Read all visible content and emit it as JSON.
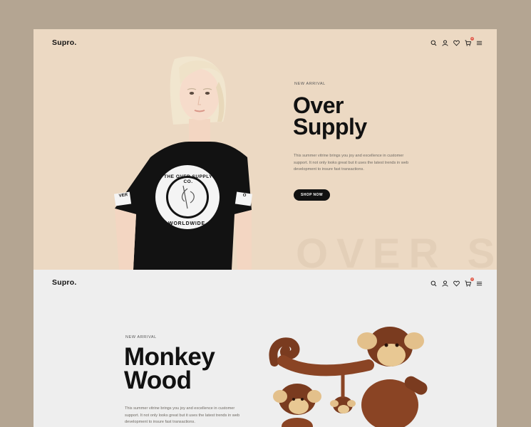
{
  "hero_one": {
    "logo": "Supro.",
    "eyebrow": "NEW ARRIVAL",
    "title_line1": "Over",
    "title_line2": "Supply",
    "description": "This summer vitrine brings you joy and excellence in customer support. It not only looks great but it uses the latest trends in web development to insure fast transactions.",
    "cta": "SHOP NOW",
    "watermark": "OVER S",
    "shirt_print_top": "THE OVER SUPPLY CO.",
    "shirt_print_bottom": "WORLDWIDE",
    "sleeve_left": "VER",
    "sleeve_right": "O",
    "cart_count": "0"
  },
  "hero_two": {
    "logo": "Supro.",
    "eyebrow": "NEW ARRIVAL",
    "title_line1": "Monkey",
    "title_line2": "Wood",
    "description": "This summer vitrine brings you joy and excellence in customer support. It not only looks great but it uses the latest trends in web development to insure fast transactions.",
    "cart_count": "0"
  },
  "icons": [
    "search-icon",
    "user-icon",
    "heart-icon",
    "cart-icon",
    "menu-icon"
  ],
  "colors": {
    "page_bg": "#b4a592",
    "hero_one_bg": "#ecd9c3",
    "hero_two_bg": "#eeeeee",
    "accent": "#e05b4a",
    "button": "#111111"
  }
}
